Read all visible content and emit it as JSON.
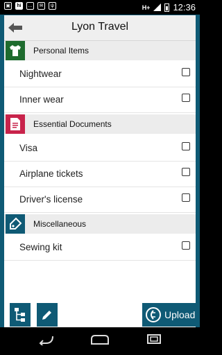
{
  "status_bar": {
    "time": "12:36",
    "network": "H+",
    "left_icons": [
      "screenshot-icon",
      "hi-app-icon",
      "sms-icon",
      "mail-icon",
      "usb-icon"
    ]
  },
  "app": {
    "title": "Lyon Travel"
  },
  "sections": [
    {
      "label": "Personal Items",
      "icon": "shirt-icon",
      "color": "#1e6b2e",
      "items": [
        {
          "label": "Nightwear",
          "checked": false
        },
        {
          "label": "Inner wear",
          "checked": false
        }
      ]
    },
    {
      "label": "Essential Documents",
      "icon": "document-icon",
      "color": "#c8234b",
      "items": [
        {
          "label": "Visa",
          "checked": false
        },
        {
          "label": "Airplane tickets",
          "checked": false
        },
        {
          "label": "Driver's license",
          "checked": false
        }
      ]
    },
    {
      "label": "Miscellaneous",
      "icon": "tag-icon",
      "color": "#0f5a75",
      "items": [
        {
          "label": "Sewing kit",
          "checked": false
        }
      ]
    }
  ],
  "bottom_bar": {
    "upload_label": "Upload",
    "accent": "#0f5a75"
  }
}
